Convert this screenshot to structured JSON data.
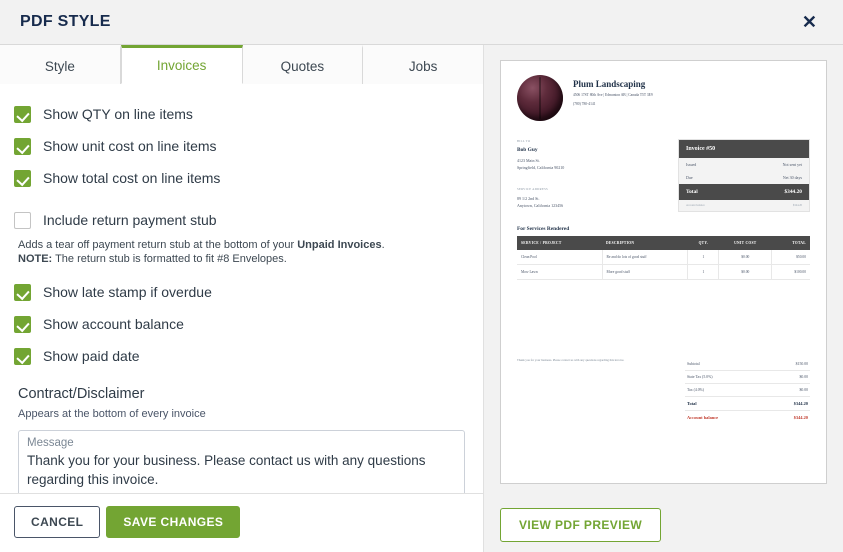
{
  "header": {
    "title": "PDF STYLE",
    "close_label": "✕"
  },
  "tabs": [
    {
      "label": "Style",
      "active": false
    },
    {
      "label": "Invoices",
      "active": true
    },
    {
      "label": "Quotes",
      "active": false
    },
    {
      "label": "Jobs",
      "active": false
    }
  ],
  "options": [
    {
      "label": "Show QTY on line items",
      "checked": true
    },
    {
      "label": "Show unit cost on line items",
      "checked": true
    },
    {
      "label": "Show total cost on line items",
      "checked": true
    },
    {
      "label": "Include return payment stub",
      "checked": false
    },
    {
      "label": "Show late stamp if overdue",
      "checked": true
    },
    {
      "label": "Show account balance",
      "checked": true
    },
    {
      "label": "Show paid date",
      "checked": true
    }
  ],
  "stub_help": {
    "line1_a": "Adds a tear off payment return stub at the bottom of your ",
    "line1_b": "Unpaid Invoices",
    "line1_c": ".",
    "line2_a": "NOTE:",
    "line2_b": " The return stub is formatted to fit #8 Envelopes."
  },
  "contract": {
    "title": "Contract/Disclaimer",
    "subtitle": "Appears at the bottom of every invoice",
    "message_legend": "Message",
    "message_value": "Thank you for your business. Please contact us with any questions regarding this invoice.",
    "message_placeholder": "Message"
  },
  "footer": {
    "cancel_label": "CANCEL",
    "save_label": "SAVE CHANGES",
    "preview_label": "VIEW PDF PREVIEW"
  },
  "colors": {
    "accent_green": "#73a533",
    "header_bg": "#f2f2f2",
    "text_dark": "#172b4d",
    "balance_red": "#c0392b"
  },
  "pdf_preview": {
    "business_name": "Plum Landscaping",
    "business_address": "4506 17ST 80th Ave  |  Edmonton AB  |  Canada T5T 3E9",
    "business_phone": "(780) 780-4141",
    "bill_to_label": "BILL TO",
    "customer_name": "Bob Guy",
    "customer_address_1": "4123 Main St.",
    "customer_address_2": "Springfield, California 90210",
    "service_label": "SERVICE ADDRESS",
    "service_address_1": "89 1/2 2nd St.",
    "service_address_2": "Anytown, California 123456",
    "invoice_title": "Invoice #50",
    "issued_label": "Issued",
    "issued_value": "Not sent yet",
    "due_label": "Due",
    "due_value": "Net 30 days",
    "total_label": "Total",
    "total_value": "$344.20",
    "foot_left": "Account balance",
    "foot_right": "$344.20",
    "services_title": "For Services Rendered",
    "table_headers": [
      "SERVICE / PROJECT",
      "DESCRIPTION",
      "QTY.",
      "UNIT COST",
      "TOTAL"
    ],
    "table_rows": [
      [
        "Clean Pool",
        "Re and do lots of good stuff",
        "1",
        "$0.00",
        "$50.00"
      ],
      [
        "Mow Lawn",
        "More good stuff",
        "1",
        "$0.00",
        "$100.00"
      ]
    ],
    "note": "Thank you for your business. Please contact us with any questions regarding this invoice.",
    "totals": [
      {
        "label": "Subtotal",
        "value": "$150.00",
        "style": "normal"
      },
      {
        "label": "State Tax (5.0%)",
        "value": "$0.00",
        "style": "normal"
      },
      {
        "label": "Tax (4.0%)",
        "value": "$0.00",
        "style": "normal"
      },
      {
        "label": "Total",
        "value": "$344.20",
        "style": "strong"
      },
      {
        "label": "Account balance",
        "value": "$344.20",
        "style": "balance"
      }
    ]
  }
}
